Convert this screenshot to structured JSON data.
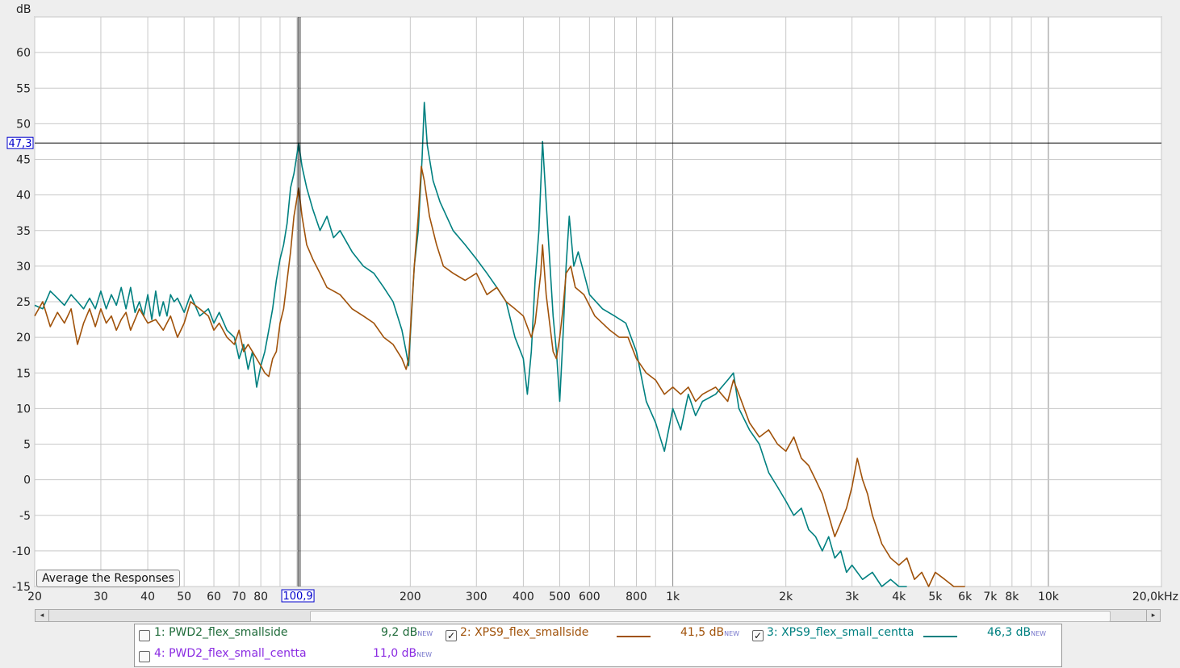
{
  "chart_data": {
    "type": "line",
    "ylabel": "dB",
    "x_scale": "log",
    "xlim": [
      20,
      20000
    ],
    "ylim": [
      -15,
      65
    ],
    "x_ticks": [
      {
        "v": 20,
        "label": "20"
      },
      {
        "v": 30,
        "label": "30"
      },
      {
        "v": 40,
        "label": "40"
      },
      {
        "v": 50,
        "label": "50"
      },
      {
        "v": 60,
        "label": "60"
      },
      {
        "v": 70,
        "label": "70"
      },
      {
        "v": 80,
        "label": "80"
      },
      {
        "v": 200,
        "label": "200"
      },
      {
        "v": 300,
        "label": "300"
      },
      {
        "v": 400,
        "label": "400"
      },
      {
        "v": 500,
        "label": "500"
      },
      {
        "v": 600,
        "label": "600"
      },
      {
        "v": 800,
        "label": "800"
      },
      {
        "v": 1000,
        "label": "1k"
      },
      {
        "v": 2000,
        "label": "2k"
      },
      {
        "v": 3000,
        "label": "3k"
      },
      {
        "v": 4000,
        "label": "4k"
      },
      {
        "v": 5000,
        "label": "5k"
      },
      {
        "v": 6000,
        "label": "6k"
      },
      {
        "v": 7000,
        "label": "7k"
      },
      {
        "v": 8000,
        "label": "8k"
      },
      {
        "v": 10000,
        "label": "10k"
      },
      {
        "v": 20000,
        "label": "20,0kHz"
      }
    ],
    "y_ticks": [
      60,
      55,
      50,
      45,
      40,
      35,
      30,
      25,
      20,
      15,
      10,
      5,
      0,
      -5,
      -10,
      -15
    ],
    "cursor": {
      "x": 100.9,
      "x_label": "100,9",
      "y": 47.3,
      "y_label": "47,3"
    },
    "grid": true,
    "series": [
      {
        "name": "XPS9_flex_small_centta",
        "color": "#008080",
        "points": [
          [
            20,
            24.5
          ],
          [
            21,
            24
          ],
          [
            22,
            26.5
          ],
          [
            23,
            25.5
          ],
          [
            24,
            24.5
          ],
          [
            25,
            26
          ],
          [
            26,
            25
          ],
          [
            27,
            24
          ],
          [
            28,
            25.5
          ],
          [
            29,
            24
          ],
          [
            30,
            26.5
          ],
          [
            31,
            24
          ],
          [
            32,
            26
          ],
          [
            33,
            24.5
          ],
          [
            34,
            27
          ],
          [
            35,
            24
          ],
          [
            36,
            27
          ],
          [
            37,
            23.5
          ],
          [
            38,
            25
          ],
          [
            39,
            23
          ],
          [
            40,
            26
          ],
          [
            41,
            22.5
          ],
          [
            42,
            26.5
          ],
          [
            43,
            23
          ],
          [
            44,
            25
          ],
          [
            45,
            23
          ],
          [
            46,
            26
          ],
          [
            47,
            25
          ],
          [
            48,
            25.5
          ],
          [
            50,
            23.5
          ],
          [
            52,
            26
          ],
          [
            55,
            23
          ],
          [
            58,
            24
          ],
          [
            60,
            22
          ],
          [
            62,
            23.5
          ],
          [
            65,
            21
          ],
          [
            68,
            20
          ],
          [
            70,
            17
          ],
          [
            72,
            19
          ],
          [
            74,
            15.5
          ],
          [
            76,
            18
          ],
          [
            78,
            13
          ],
          [
            80,
            16
          ],
          [
            82,
            18
          ],
          [
            84,
            21
          ],
          [
            86,
            24
          ],
          [
            88,
            28
          ],
          [
            90,
            31
          ],
          [
            92,
            33
          ],
          [
            94,
            36
          ],
          [
            96,
            41
          ],
          [
            98,
            43
          ],
          [
            100.9,
            47.3
          ],
          [
            103,
            44
          ],
          [
            106,
            41
          ],
          [
            110,
            38
          ],
          [
            115,
            35
          ],
          [
            120,
            37
          ],
          [
            125,
            34
          ],
          [
            130,
            35
          ],
          [
            140,
            32
          ],
          [
            150,
            30
          ],
          [
            160,
            29
          ],
          [
            170,
            27
          ],
          [
            180,
            25
          ],
          [
            190,
            21
          ],
          [
            195,
            18
          ],
          [
            198,
            16
          ],
          [
            205,
            30
          ],
          [
            210,
            35
          ],
          [
            215,
            45
          ],
          [
            218,
            53
          ],
          [
            222,
            47
          ],
          [
            230,
            42
          ],
          [
            240,
            39
          ],
          [
            260,
            35
          ],
          [
            280,
            33
          ],
          [
            300,
            31
          ],
          [
            320,
            29
          ],
          [
            340,
            27
          ],
          [
            360,
            25
          ],
          [
            380,
            20
          ],
          [
            400,
            17
          ],
          [
            410,
            12
          ],
          [
            420,
            18
          ],
          [
            430,
            28
          ],
          [
            440,
            35
          ],
          [
            450,
            47.5
          ],
          [
            465,
            35
          ],
          [
            480,
            23
          ],
          [
            490,
            18
          ],
          [
            500,
            11
          ],
          [
            510,
            20
          ],
          [
            520,
            30
          ],
          [
            530,
            37
          ],
          [
            545,
            30
          ],
          [
            560,
            32
          ],
          [
            580,
            29
          ],
          [
            600,
            26
          ],
          [
            650,
            24
          ],
          [
            700,
            23
          ],
          [
            750,
            22
          ],
          [
            800,
            18
          ],
          [
            850,
            11
          ],
          [
            900,
            8
          ],
          [
            950,
            4
          ],
          [
            1000,
            10
          ],
          [
            1050,
            7
          ],
          [
            1100,
            12
          ],
          [
            1150,
            9
          ],
          [
            1200,
            11
          ],
          [
            1300,
            12
          ],
          [
            1400,
            14
          ],
          [
            1450,
            15
          ],
          [
            1500,
            10
          ],
          [
            1600,
            7
          ],
          [
            1700,
            5
          ],
          [
            1800,
            1
          ],
          [
            1900,
            -1
          ],
          [
            2000,
            -3
          ],
          [
            2100,
            -5
          ],
          [
            2200,
            -4
          ],
          [
            2300,
            -7
          ],
          [
            2400,
            -8
          ],
          [
            2500,
            -10
          ],
          [
            2600,
            -8
          ],
          [
            2700,
            -11
          ],
          [
            2800,
            -10
          ],
          [
            2900,
            -13
          ],
          [
            3000,
            -12
          ],
          [
            3200,
            -14
          ],
          [
            3400,
            -13
          ],
          [
            3600,
            -15
          ],
          [
            3800,
            -14
          ],
          [
            4000,
            -15
          ],
          [
            4200,
            -15
          ]
        ]
      },
      {
        "name": "XPS9_flex_smallside",
        "color": "#a0520a",
        "points": [
          [
            20,
            23
          ],
          [
            21,
            25
          ],
          [
            22,
            21.5
          ],
          [
            23,
            23.5
          ],
          [
            24,
            22
          ],
          [
            25,
            24
          ],
          [
            26,
            19
          ],
          [
            27,
            22
          ],
          [
            28,
            24
          ],
          [
            29,
            21.5
          ],
          [
            30,
            24
          ],
          [
            31,
            22
          ],
          [
            32,
            23
          ],
          [
            33,
            21
          ],
          [
            34,
            22.5
          ],
          [
            35,
            23.5
          ],
          [
            36,
            21
          ],
          [
            38,
            24
          ],
          [
            40,
            22
          ],
          [
            42,
            22.5
          ],
          [
            44,
            21
          ],
          [
            46,
            23
          ],
          [
            48,
            20
          ],
          [
            50,
            22
          ],
          [
            52,
            25
          ],
          [
            55,
            24
          ],
          [
            58,
            23
          ],
          [
            60,
            21
          ],
          [
            62,
            22
          ],
          [
            65,
            20
          ],
          [
            68,
            19
          ],
          [
            70,
            21
          ],
          [
            72,
            18
          ],
          [
            74,
            19
          ],
          [
            76,
            18
          ],
          [
            78,
            17
          ],
          [
            80,
            16
          ],
          [
            82,
            15
          ],
          [
            84,
            14.5
          ],
          [
            86,
            17
          ],
          [
            88,
            18
          ],
          [
            90,
            22
          ],
          [
            92,
            24
          ],
          [
            94,
            28
          ],
          [
            96,
            32
          ],
          [
            98,
            37
          ],
          [
            100.9,
            41
          ],
          [
            103,
            37
          ],
          [
            106,
            33
          ],
          [
            110,
            31
          ],
          [
            115,
            29
          ],
          [
            120,
            27
          ],
          [
            130,
            26
          ],
          [
            140,
            24
          ],
          [
            150,
            23
          ],
          [
            160,
            22
          ],
          [
            170,
            20
          ],
          [
            180,
            19
          ],
          [
            190,
            17
          ],
          [
            195,
            15.5
          ],
          [
            198,
            17
          ],
          [
            205,
            30
          ],
          [
            210,
            37
          ],
          [
            214,
            44
          ],
          [
            218,
            42
          ],
          [
            225,
            37
          ],
          [
            235,
            33
          ],
          [
            245,
            30
          ],
          [
            260,
            29
          ],
          [
            280,
            28
          ],
          [
            300,
            29
          ],
          [
            320,
            26
          ],
          [
            340,
            27
          ],
          [
            360,
            25
          ],
          [
            380,
            24
          ],
          [
            400,
            23
          ],
          [
            420,
            20
          ],
          [
            430,
            22
          ],
          [
            445,
            29
          ],
          [
            450,
            33
          ],
          [
            460,
            26
          ],
          [
            470,
            22
          ],
          [
            480,
            18
          ],
          [
            490,
            17
          ],
          [
            500,
            20
          ],
          [
            510,
            24
          ],
          [
            520,
            29
          ],
          [
            535,
            30
          ],
          [
            550,
            27
          ],
          [
            580,
            26
          ],
          [
            620,
            23
          ],
          [
            680,
            21
          ],
          [
            720,
            20
          ],
          [
            760,
            20
          ],
          [
            800,
            17
          ],
          [
            850,
            15
          ],
          [
            900,
            14
          ],
          [
            950,
            12
          ],
          [
            1000,
            13
          ],
          [
            1050,
            12
          ],
          [
            1100,
            13
          ],
          [
            1150,
            11
          ],
          [
            1200,
            12
          ],
          [
            1300,
            13
          ],
          [
            1400,
            11
          ],
          [
            1450,
            14
          ],
          [
            1500,
            12
          ],
          [
            1600,
            8
          ],
          [
            1700,
            6
          ],
          [
            1800,
            7
          ],
          [
            1900,
            5
          ],
          [
            2000,
            4
          ],
          [
            2100,
            6
          ],
          [
            2200,
            3
          ],
          [
            2300,
            2
          ],
          [
            2400,
            0
          ],
          [
            2500,
            -2
          ],
          [
            2600,
            -5
          ],
          [
            2700,
            -8
          ],
          [
            2800,
            -6
          ],
          [
            2900,
            -4
          ],
          [
            3000,
            -1
          ],
          [
            3100,
            3
          ],
          [
            3200,
            0
          ],
          [
            3300,
            -2
          ],
          [
            3400,
            -5
          ],
          [
            3500,
            -7
          ],
          [
            3600,
            -9
          ],
          [
            3800,
            -11
          ],
          [
            4000,
            -12
          ],
          [
            4200,
            -11
          ],
          [
            4400,
            -14
          ],
          [
            4600,
            -13
          ],
          [
            4800,
            -15
          ],
          [
            5000,
            -13
          ],
          [
            5300,
            -14
          ],
          [
            5600,
            -15
          ],
          [
            6000,
            -15
          ]
        ]
      }
    ]
  },
  "buttons": {
    "average_label": "Average the Responses"
  },
  "scrollbar": {
    "left_arrow": "◂",
    "right_arrow": "▸"
  },
  "legend": {
    "items": [
      {
        "label": "1: PWD2_flex_smallside",
        "value": "9,2 dB",
        "badge": "NEW",
        "checked": false,
        "color": "#1f6b3a"
      },
      {
        "label": "2: XPS9_flex_smallside",
        "value": "41,5 dB",
        "badge": "NEW",
        "checked": true,
        "color": "#a0520a"
      },
      {
        "label": "3: XPS9_flex_small_centta",
        "value": "46,3 dB",
        "badge": "NEW",
        "checked": true,
        "color": "#008080"
      },
      {
        "label": "4: PWD2_flex_small_centta",
        "value": "11,0 dB",
        "badge": "NEW",
        "checked": false,
        "color": "#8a2be2"
      }
    ],
    "check_mark": "✓"
  }
}
